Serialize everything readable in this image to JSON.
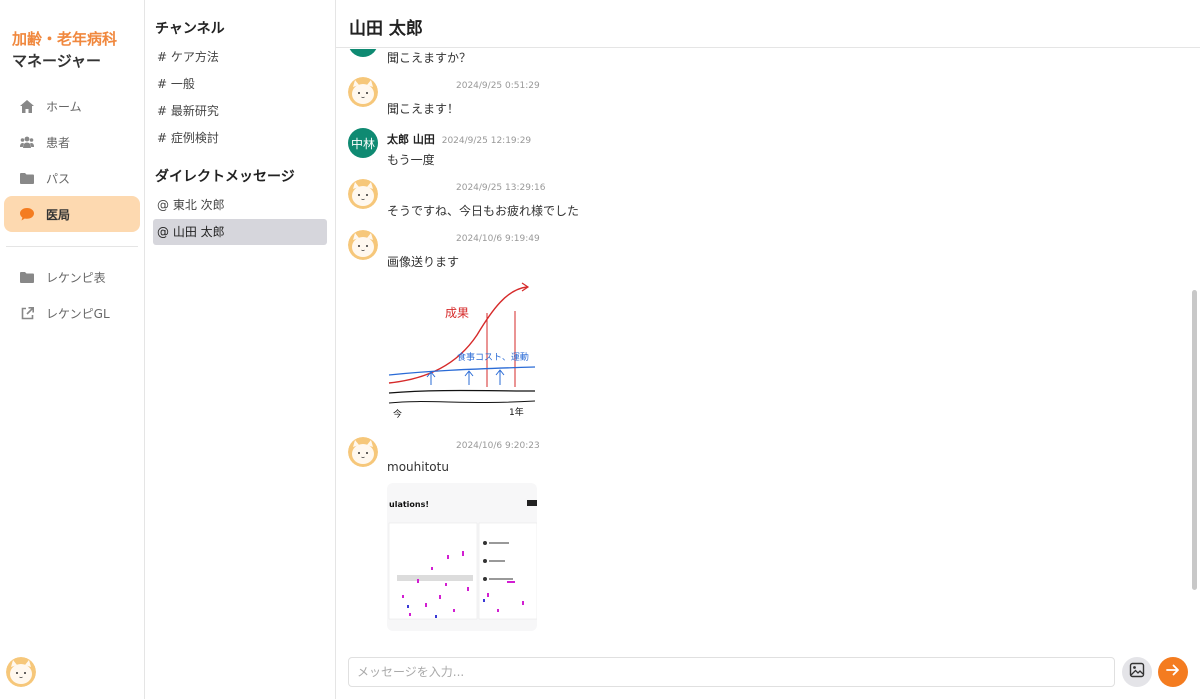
{
  "nav": {
    "brand_line1": "加齢・老年病科",
    "brand_line2": "マネージャー",
    "items": [
      {
        "label": "ホーム",
        "icon": "home-icon"
      },
      {
        "label": "患者",
        "icon": "users-icon"
      },
      {
        "label": "パス",
        "icon": "folder-icon"
      },
      {
        "label": "医局",
        "icon": "chat-bubble-icon",
        "active": true
      }
    ],
    "items2": [
      {
        "label": "レケンピ表",
        "icon": "folder-icon"
      },
      {
        "label": "レケンピGL",
        "icon": "external-link-icon"
      }
    ]
  },
  "channels": {
    "channels_title": "チャンネル",
    "channel_items": [
      "# ケア方法",
      "# 一般",
      "# 最新研究",
      "# 症例検討"
    ],
    "dm_title": "ダイレクトメッセージ",
    "dm_items": [
      "@ 東北 次郎",
      "@ 山田 太郎"
    ]
  },
  "header": {
    "title": "山田 太郎"
  },
  "messages": [
    {
      "text": "聞こえますか？"
    },
    {
      "time": "2024/9/25 0:51:29",
      "text": "聞こえます！"
    },
    {
      "avatar_text": "中林",
      "name": "太郎 山田",
      "time": "2024/9/25 12:19:29",
      "text": "もう一度"
    },
    {
      "time": "2024/9/25 13:29:16",
      "text": "そうですね、今日もお疲れ様でした"
    },
    {
      "time": "2024/10/6 9:19:49",
      "text": "画像送ります",
      "image_text": {
        "curve_label": "成果",
        "line_label": "食事コスト、運動",
        "start": "今",
        "end": "1年"
      }
    },
    {
      "time": "2024/10/6 9:20:23",
      "text": "mouhitotu",
      "image_text": {
        "heading": "ulations!"
      }
    }
  ],
  "composer": {
    "placeholder": "メッセージを入力..."
  },
  "colors": {
    "accent": "#f47c20",
    "brand": "#f0883e",
    "active_nav": "#fdd9b0",
    "avatar_green": "#0f8a72"
  }
}
